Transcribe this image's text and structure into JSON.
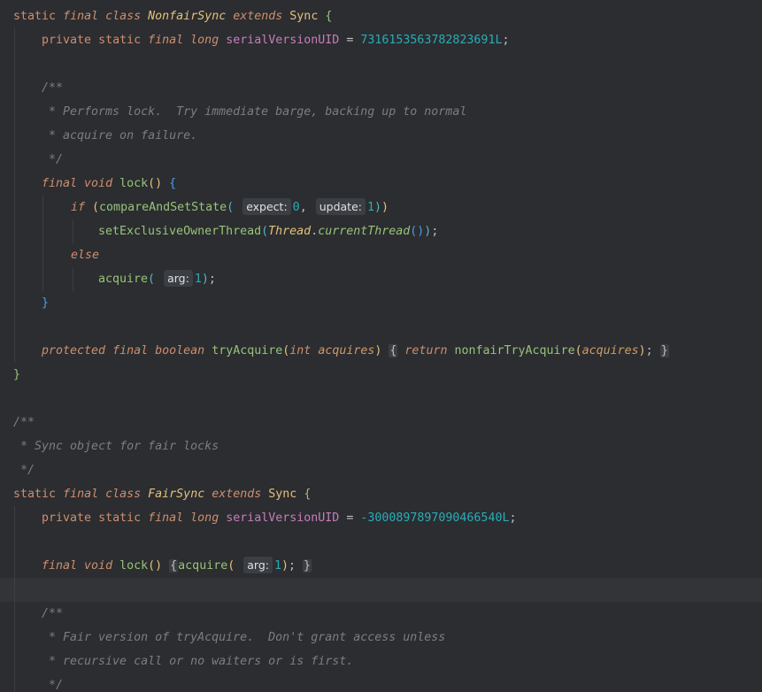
{
  "code": {
    "l1": {
      "static": "static",
      "final": "final",
      "class": "class",
      "name": "NonfairSync",
      "extends": "extends",
      "parent": "Sync",
      "brace": "{"
    },
    "l2": {
      "private": "private",
      "static": "static",
      "final": "final",
      "long": "long",
      "field": "serialVersionUID",
      "eq": " = ",
      "value": "7316153563782823691L",
      "semi": ";"
    },
    "l4": {
      "text": "/**"
    },
    "l5": {
      "text": " * Performs lock.  Try immediate barge, backing up to normal"
    },
    "l6": {
      "text": " * acquire on failure."
    },
    "l7": {
      "text": " */"
    },
    "l8": {
      "final": "final",
      "void": "void",
      "name": "lock",
      "parens": "()",
      "brace": "{"
    },
    "l9": {
      "if": "if",
      "open": "(",
      "method": "compareAndSetState",
      "open2": "(",
      "hint1": "expect:",
      "arg1": "0",
      "comma": ",",
      "hint2": "update:",
      "arg2": "1",
      "close2": ")",
      "close": ")"
    },
    "l10": {
      "method": "setExclusiveOwnerThread",
      "open": "(",
      "cls": "Thread",
      "dot": ".",
      "call": "currentThread",
      "parens": "()",
      "close": ")",
      "semi": ";"
    },
    "l11": {
      "else": "else"
    },
    "l12": {
      "method": "acquire",
      "open": "(",
      "hint": "arg:",
      "arg": "1",
      "close": ")",
      "semi": ";"
    },
    "l13": {
      "brace": "}"
    },
    "l15": {
      "protected": "protected",
      "final": "final",
      "boolean": "boolean",
      "name": "tryAcquire",
      "open": "(",
      "int": "int",
      "param": "acquires",
      "close": ")",
      "bopen": "{",
      "return": "return",
      "call": "nonfairTryAcquire",
      "copen": "(",
      "arg": "acquires",
      "cclose": ")",
      "semi": ";",
      "bclose": "}"
    },
    "l16": {
      "brace": "}"
    },
    "l18": {
      "text": "/**"
    },
    "l19": {
      "text": " * Sync object for fair locks"
    },
    "l20": {
      "text": " */"
    },
    "l21": {
      "static": "static",
      "final": "final",
      "class": "class",
      "name": "FairSync",
      "extends": "extends",
      "parent": "Sync",
      "brace": "{"
    },
    "l22": {
      "private": "private",
      "static": "static",
      "final": "final",
      "long": "long",
      "field": "serialVersionUID",
      "eq": " = ",
      "value": "-3000897897090466540L",
      "semi": ";"
    },
    "l24": {
      "final": "final",
      "void": "void",
      "name": "lock",
      "parens": "()",
      "bopen": "{",
      "call": "acquire",
      "open": "(",
      "hint": "arg:",
      "arg": "1",
      "close": ")",
      "semi": ";",
      "bclose": "}"
    },
    "l26": {
      "text": "/**"
    },
    "l27": {
      "text": " * Fair version of tryAcquire.  Don't grant access unless"
    },
    "l28": {
      "text": " * recursive call or no waiters or is first."
    },
    "l29": {
      "text": " */"
    }
  }
}
